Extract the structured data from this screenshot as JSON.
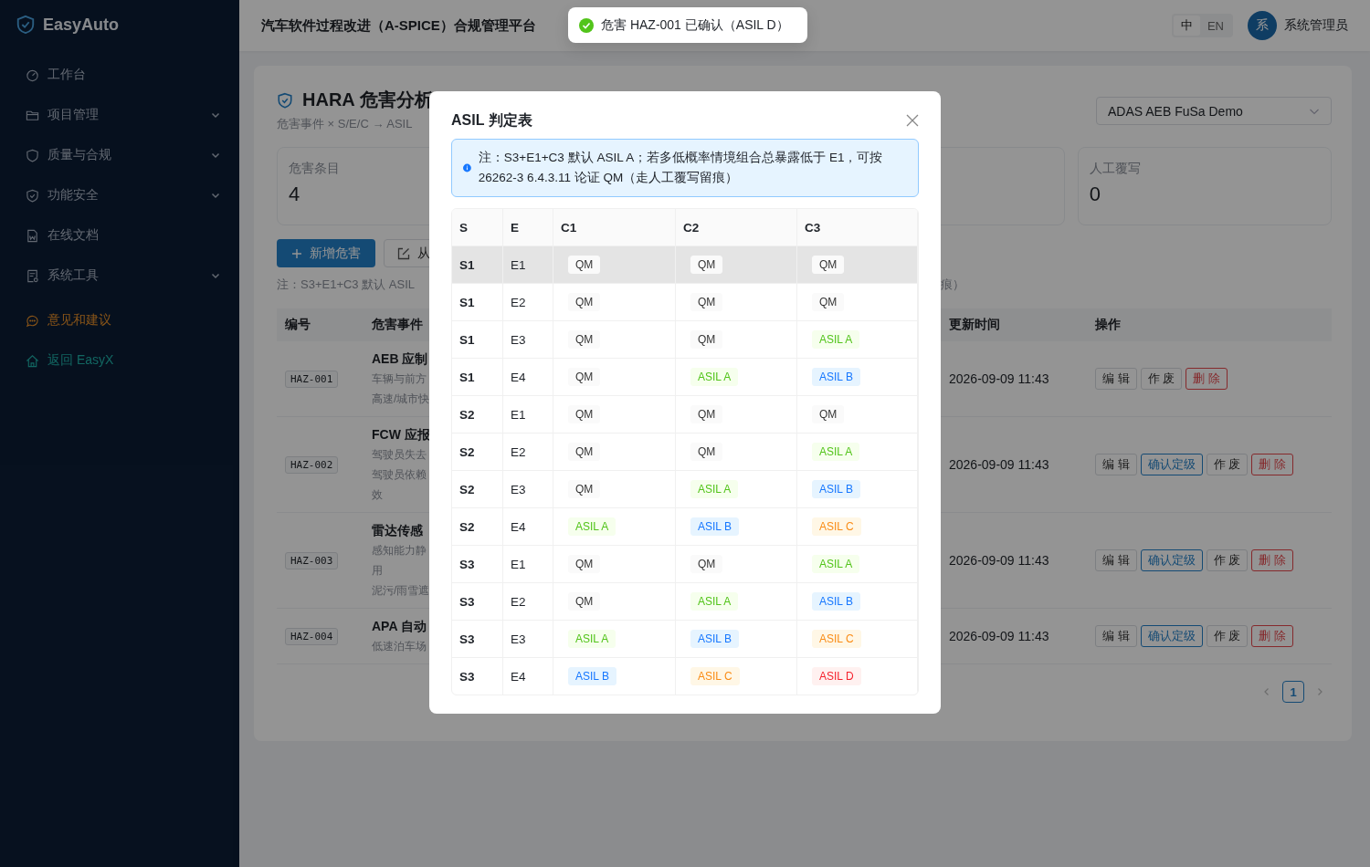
{
  "sidebar": {
    "brand": "EasyAuto",
    "items": [
      {
        "label": "工作台",
        "kind": "nav",
        "expandable": false
      },
      {
        "label": "项目管理",
        "kind": "nav",
        "expandable": true
      },
      {
        "label": "质量与合规",
        "kind": "nav",
        "expandable": true
      },
      {
        "label": "功能安全",
        "kind": "nav",
        "expandable": true
      },
      {
        "label": "在线文档",
        "kind": "nav",
        "expandable": false
      },
      {
        "label": "系统工具",
        "kind": "nav",
        "expandable": true
      },
      {
        "label": "意见和建议",
        "kind": "feedback",
        "expandable": false
      },
      {
        "label": "返回 EasyX",
        "kind": "link",
        "expandable": false
      }
    ]
  },
  "header": {
    "title": "汽车软件过程改进（A-SPICE）合规管理平台",
    "languages": [
      {
        "label": "中",
        "selected": true
      },
      {
        "label": "EN",
        "selected": false
      }
    ],
    "avatar": "系",
    "user": "系统管理员"
  },
  "toast": {
    "text": "危害 HAZ-001 已确认（ASIL D）",
    "kind": "success"
  },
  "page": {
    "title": "HARA 危害分析",
    "subtitle": "危害事件 × S/E/C → ASIL",
    "project_select": "ADAS AEB FuSa Demo",
    "stats": [
      {
        "label": "危害条目",
        "value": "4"
      },
      {
        "label": "人工覆写",
        "value": "0"
      }
    ],
    "buttons": [
      {
        "label": "新增危害",
        "kind": "primary"
      },
      {
        "label": "从",
        "kind": "import"
      }
    ],
    "note_start": "注：S3+E1+C3 默认 ASIL",
    "note_end": "痕）"
  },
  "hazard_table": {
    "columns": [
      "编号",
      "危害事件",
      "更新时间",
      "操作"
    ],
    "rows": [
      {
        "id": "HAZ-001",
        "event_title": "AEB 应制",
        "event_lines": [
          "车辆与前方",
          "高速/城市快"
        ],
        "updated": "2026-09-09 11:43",
        "actions": [
          {
            "label": "编 辑",
            "kind": "default"
          },
          {
            "label": "作 废",
            "kind": "default"
          },
          {
            "label": "删 除",
            "kind": "danger"
          }
        ]
      },
      {
        "id": "HAZ-002",
        "event_title": "FCW 应报",
        "event_lines": [
          "驾驶员失去",
          "驾驶员依赖",
          "效"
        ],
        "updated": "2026-09-09 11:43",
        "actions": [
          {
            "label": "编 辑",
            "kind": "default"
          },
          {
            "label": "确认定级",
            "kind": "confirm"
          },
          {
            "label": "作 废",
            "kind": "default"
          },
          {
            "label": "删 除",
            "kind": "danger"
          }
        ]
      },
      {
        "id": "HAZ-003",
        "event_title": "雷达传感",
        "event_lines": [
          "感知能力静",
          "用",
          "泥污/雨雪遮"
        ],
        "updated": "2026-09-09 11:43",
        "actions": [
          {
            "label": "编 辑",
            "kind": "default"
          },
          {
            "label": "确认定级",
            "kind": "confirm"
          },
          {
            "label": "作 废",
            "kind": "default"
          },
          {
            "label": "删 除",
            "kind": "danger"
          }
        ]
      },
      {
        "id": "HAZ-004",
        "event_title": "APA 自动",
        "event_lines": [
          "低速泊车场"
        ],
        "updated": "2026-09-09 11:43",
        "actions": [
          {
            "label": "编 辑",
            "kind": "default"
          },
          {
            "label": "确认定级",
            "kind": "confirm"
          },
          {
            "label": "作 废",
            "kind": "default"
          },
          {
            "label": "删 除",
            "kind": "danger"
          }
        ]
      }
    ]
  },
  "pagination": {
    "pages": [
      {
        "label": "1",
        "selected": true
      }
    ]
  },
  "modal": {
    "title": "ASIL 判定表",
    "alert": "注：S3+E1+C3 默认 ASIL A；若多低概率情境组合总暴露低于 E1，可按 26262-3 6.4.3.11 论证 QM（走人工覆写留痕）",
    "columns": [
      "S",
      "E",
      "C1",
      "C2",
      "C3"
    ],
    "rows": [
      {
        "s": "S1",
        "e": "E1",
        "hovered": true,
        "cells": [
          {
            "text": "QM",
            "kind": "qm"
          },
          {
            "text": "QM",
            "kind": "qm"
          },
          {
            "text": "QM",
            "kind": "qm"
          }
        ]
      },
      {
        "s": "S1",
        "e": "E2",
        "hovered": false,
        "cells": [
          {
            "text": "QM",
            "kind": "qm"
          },
          {
            "text": "QM",
            "kind": "qm"
          },
          {
            "text": "QM",
            "kind": "qm"
          }
        ]
      },
      {
        "s": "S1",
        "e": "E3",
        "hovered": false,
        "cells": [
          {
            "text": "QM",
            "kind": "qm"
          },
          {
            "text": "QM",
            "kind": "qm"
          },
          {
            "text": "ASIL A",
            "kind": "a"
          }
        ]
      },
      {
        "s": "S1",
        "e": "E4",
        "hovered": false,
        "cells": [
          {
            "text": "QM",
            "kind": "qm"
          },
          {
            "text": "ASIL A",
            "kind": "a"
          },
          {
            "text": "ASIL B",
            "kind": "b"
          }
        ]
      },
      {
        "s": "S2",
        "e": "E1",
        "hovered": false,
        "cells": [
          {
            "text": "QM",
            "kind": "qm"
          },
          {
            "text": "QM",
            "kind": "qm"
          },
          {
            "text": "QM",
            "kind": "qm"
          }
        ]
      },
      {
        "s": "S2",
        "e": "E2",
        "hovered": false,
        "cells": [
          {
            "text": "QM",
            "kind": "qm"
          },
          {
            "text": "QM",
            "kind": "qm"
          },
          {
            "text": "ASIL A",
            "kind": "a"
          }
        ]
      },
      {
        "s": "S2",
        "e": "E3",
        "hovered": false,
        "cells": [
          {
            "text": "QM",
            "kind": "qm"
          },
          {
            "text": "ASIL A",
            "kind": "a"
          },
          {
            "text": "ASIL B",
            "kind": "b"
          }
        ]
      },
      {
        "s": "S2",
        "e": "E4",
        "hovered": false,
        "cells": [
          {
            "text": "ASIL A",
            "kind": "a"
          },
          {
            "text": "ASIL B",
            "kind": "b"
          },
          {
            "text": "ASIL C",
            "kind": "c"
          }
        ]
      },
      {
        "s": "S3",
        "e": "E1",
        "hovered": false,
        "cells": [
          {
            "text": "QM",
            "kind": "qm"
          },
          {
            "text": "QM",
            "kind": "qm"
          },
          {
            "text": "ASIL A",
            "kind": "a"
          }
        ]
      },
      {
        "s": "S3",
        "e": "E2",
        "hovered": false,
        "cells": [
          {
            "text": "QM",
            "kind": "qm"
          },
          {
            "text": "ASIL A",
            "kind": "a"
          },
          {
            "text": "ASIL B",
            "kind": "b"
          }
        ]
      },
      {
        "s": "S3",
        "e": "E3",
        "hovered": false,
        "cells": [
          {
            "text": "ASIL A",
            "kind": "a"
          },
          {
            "text": "ASIL B",
            "kind": "b"
          },
          {
            "text": "ASIL C",
            "kind": "c"
          }
        ]
      },
      {
        "s": "S3",
        "e": "E4",
        "hovered": false,
        "cells": [
          {
            "text": "ASIL B",
            "kind": "b"
          },
          {
            "text": "ASIL C",
            "kind": "c"
          },
          {
            "text": "ASIL D",
            "kind": "d"
          }
        ]
      }
    ]
  }
}
